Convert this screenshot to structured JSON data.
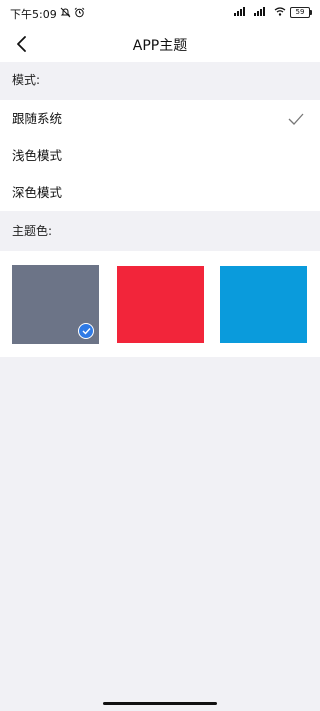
{
  "status_bar": {
    "time": "下午5:09",
    "battery": "59"
  },
  "header": {
    "title": "APP主题"
  },
  "mode_section": {
    "label": "模式:",
    "options": [
      {
        "label": "跟随系统",
        "selected": true
      },
      {
        "label": "浅色模式",
        "selected": false
      },
      {
        "label": "深色模式",
        "selected": false
      }
    ]
  },
  "color_section": {
    "label": "主题色:",
    "swatches": [
      {
        "color": "#6c7487",
        "selected": true
      },
      {
        "color": "#f2253a",
        "selected": false
      },
      {
        "color": "#0a9bdc",
        "selected": false
      }
    ]
  },
  "colors": {
    "accent": "#2f7ae5",
    "background": "#f1f1f5"
  }
}
